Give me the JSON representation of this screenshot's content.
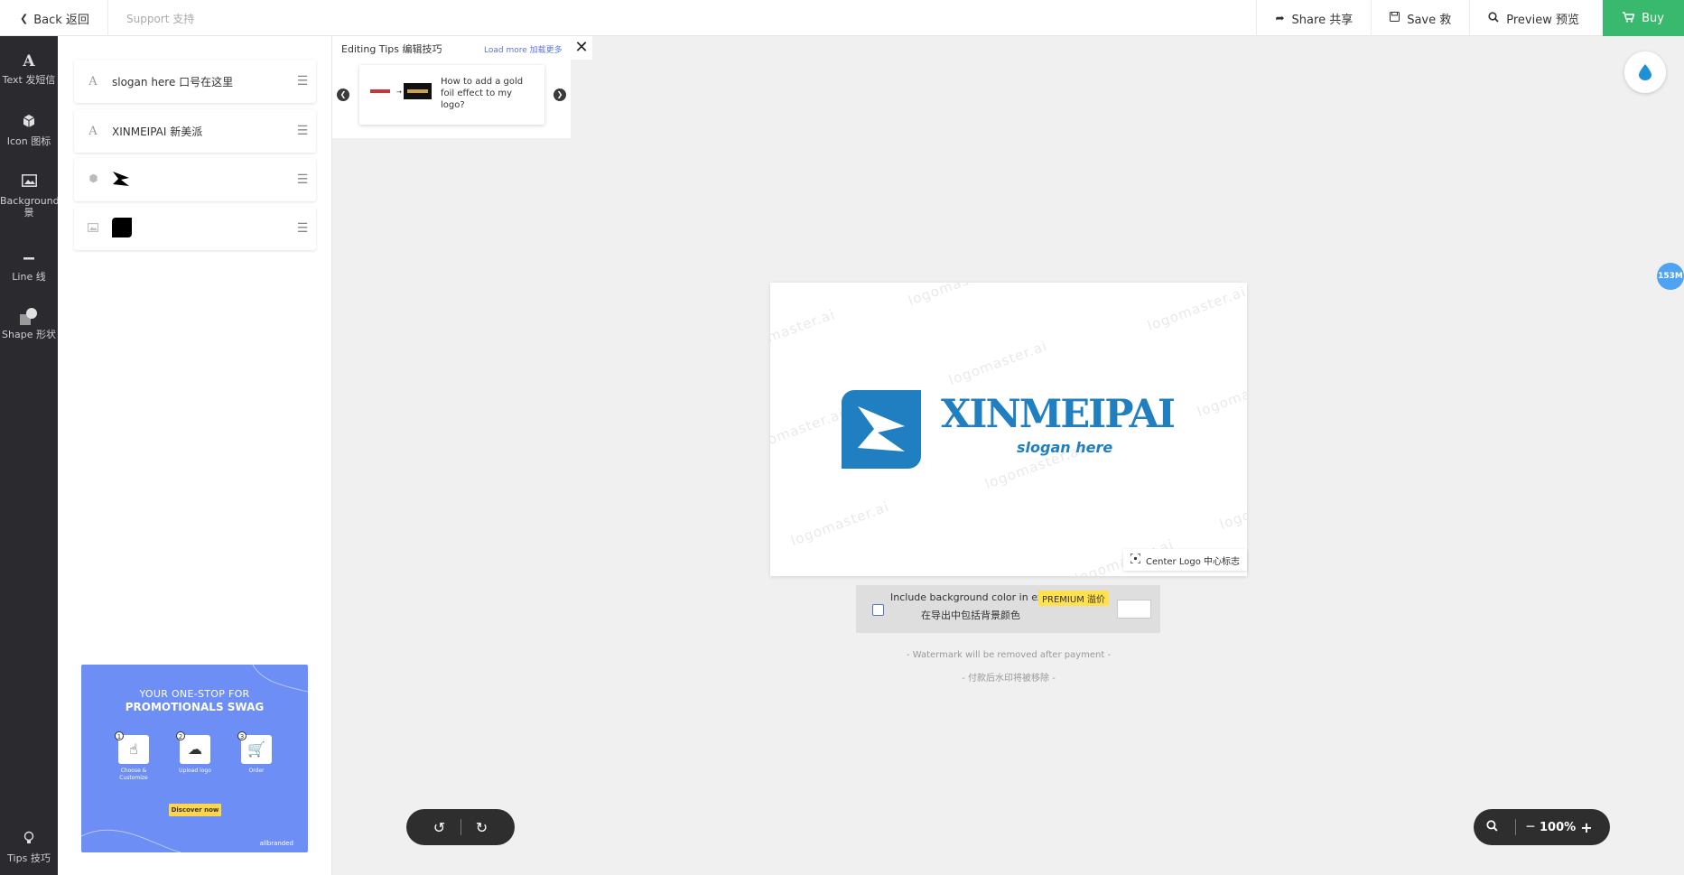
{
  "topbar": {
    "back_label": "Back 返回",
    "support_label": "Support 支持",
    "share_label": "Share 共享",
    "save_label": "Save 救",
    "preview_label": "Preview 预览",
    "buy_label": "Buy"
  },
  "rail": {
    "items": [
      {
        "label": "Text 发短信",
        "icon": "text-icon"
      },
      {
        "label": "Icon 图标",
        "icon": "cube-icon"
      },
      {
        "label": "Background 景",
        "icon": "image-icon"
      },
      {
        "label": "Line 线",
        "icon": "line-icon"
      },
      {
        "label": "Shape 形状",
        "icon": "shape-icon"
      }
    ],
    "tips_label": "Tips 技巧"
  },
  "layers": [
    {
      "type": "text",
      "label": "slogan here 口号在这里"
    },
    {
      "type": "text",
      "label": "XINMEIPAI 新美派"
    },
    {
      "type": "icon",
      "label": ""
    },
    {
      "type": "background",
      "label": ""
    }
  ],
  "ad": {
    "line1": "YOUR ONE-STOP FOR",
    "line2": "PROMOTIONALS SWAG",
    "steps": [
      {
        "num": "1",
        "label": "Choose & Customize"
      },
      {
        "num": "2",
        "label": "Upload logo"
      },
      {
        "num": "3",
        "label": "Order"
      }
    ],
    "cta": "Discover now",
    "brand": "allbranded"
  },
  "tips": {
    "title": "Editing Tips 编辑技巧",
    "load_more": "Load more 加载更多",
    "card_text": "How to add a gold foil effect to my logo?"
  },
  "logo": {
    "name": "XINMEIPAI",
    "slogan": "slogan here",
    "color": "#1f7fc0"
  },
  "watermark": "logomaster.ai",
  "center_logo_label": "Center Logo 中心标志",
  "include_bg": {
    "line1": "Include background color in exp",
    "premium": "PREMIUM 溢价",
    "line2": "在导出中包括背景颜色"
  },
  "watermark_note": {
    "en": "- Watermark will be removed after payment -",
    "cn": "- 付款后水印将被移除 -"
  },
  "zoom": {
    "value": "100%"
  },
  "badge": "153M",
  "colors": {
    "buy": "#39b96d",
    "rail": "#2b2b2f",
    "accent_blue": "#1f7fc0"
  }
}
